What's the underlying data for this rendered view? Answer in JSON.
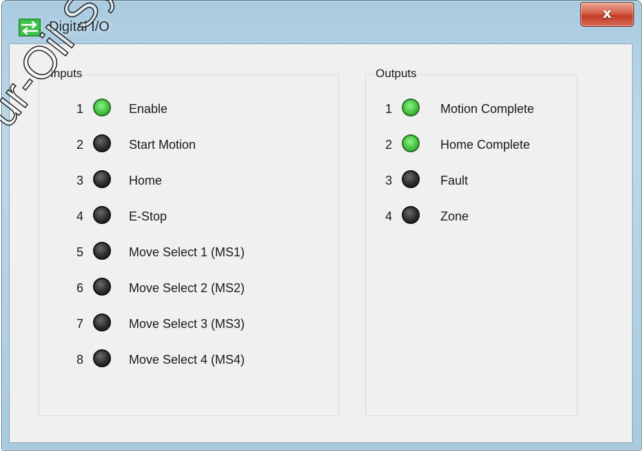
{
  "window": {
    "title": "Digital I/O",
    "close_label": "x",
    "icon": "io-exchange-icon"
  },
  "inputs": {
    "label": "Inputs",
    "items": [
      {
        "num": "1",
        "label": "Enable",
        "state": "on"
      },
      {
        "num": "2",
        "label": "Start Motion",
        "state": "off"
      },
      {
        "num": "3",
        "label": "Home",
        "state": "off"
      },
      {
        "num": "4",
        "label": "E-Stop",
        "state": "off"
      },
      {
        "num": "5",
        "label": "Move Select 1 (MS1)",
        "state": "off"
      },
      {
        "num": "6",
        "label": "Move Select 2 (MS2)",
        "state": "off"
      },
      {
        "num": "7",
        "label": "Move Select 3 (MS3)",
        "state": "off"
      },
      {
        "num": "8",
        "label": "Move Select 4 (MS4)",
        "state": "off"
      }
    ]
  },
  "outputs": {
    "label": "Outputs",
    "items": [
      {
        "num": "1",
        "label": "Motion Complete",
        "state": "on"
      },
      {
        "num": "2",
        "label": "Home Complete",
        "state": "on"
      },
      {
        "num": "3",
        "label": "Fault",
        "state": "off"
      },
      {
        "num": "4",
        "label": "Zone",
        "state": "off"
      }
    ]
  },
  "watermark": {
    "text": "ur-Oil Systems"
  },
  "colors": {
    "led_on": "#46c43f",
    "led_off": "#2f2f2f",
    "close_button": "#c23d26",
    "client_background": "#f0f0f0",
    "frame": "#a9cbe0"
  }
}
